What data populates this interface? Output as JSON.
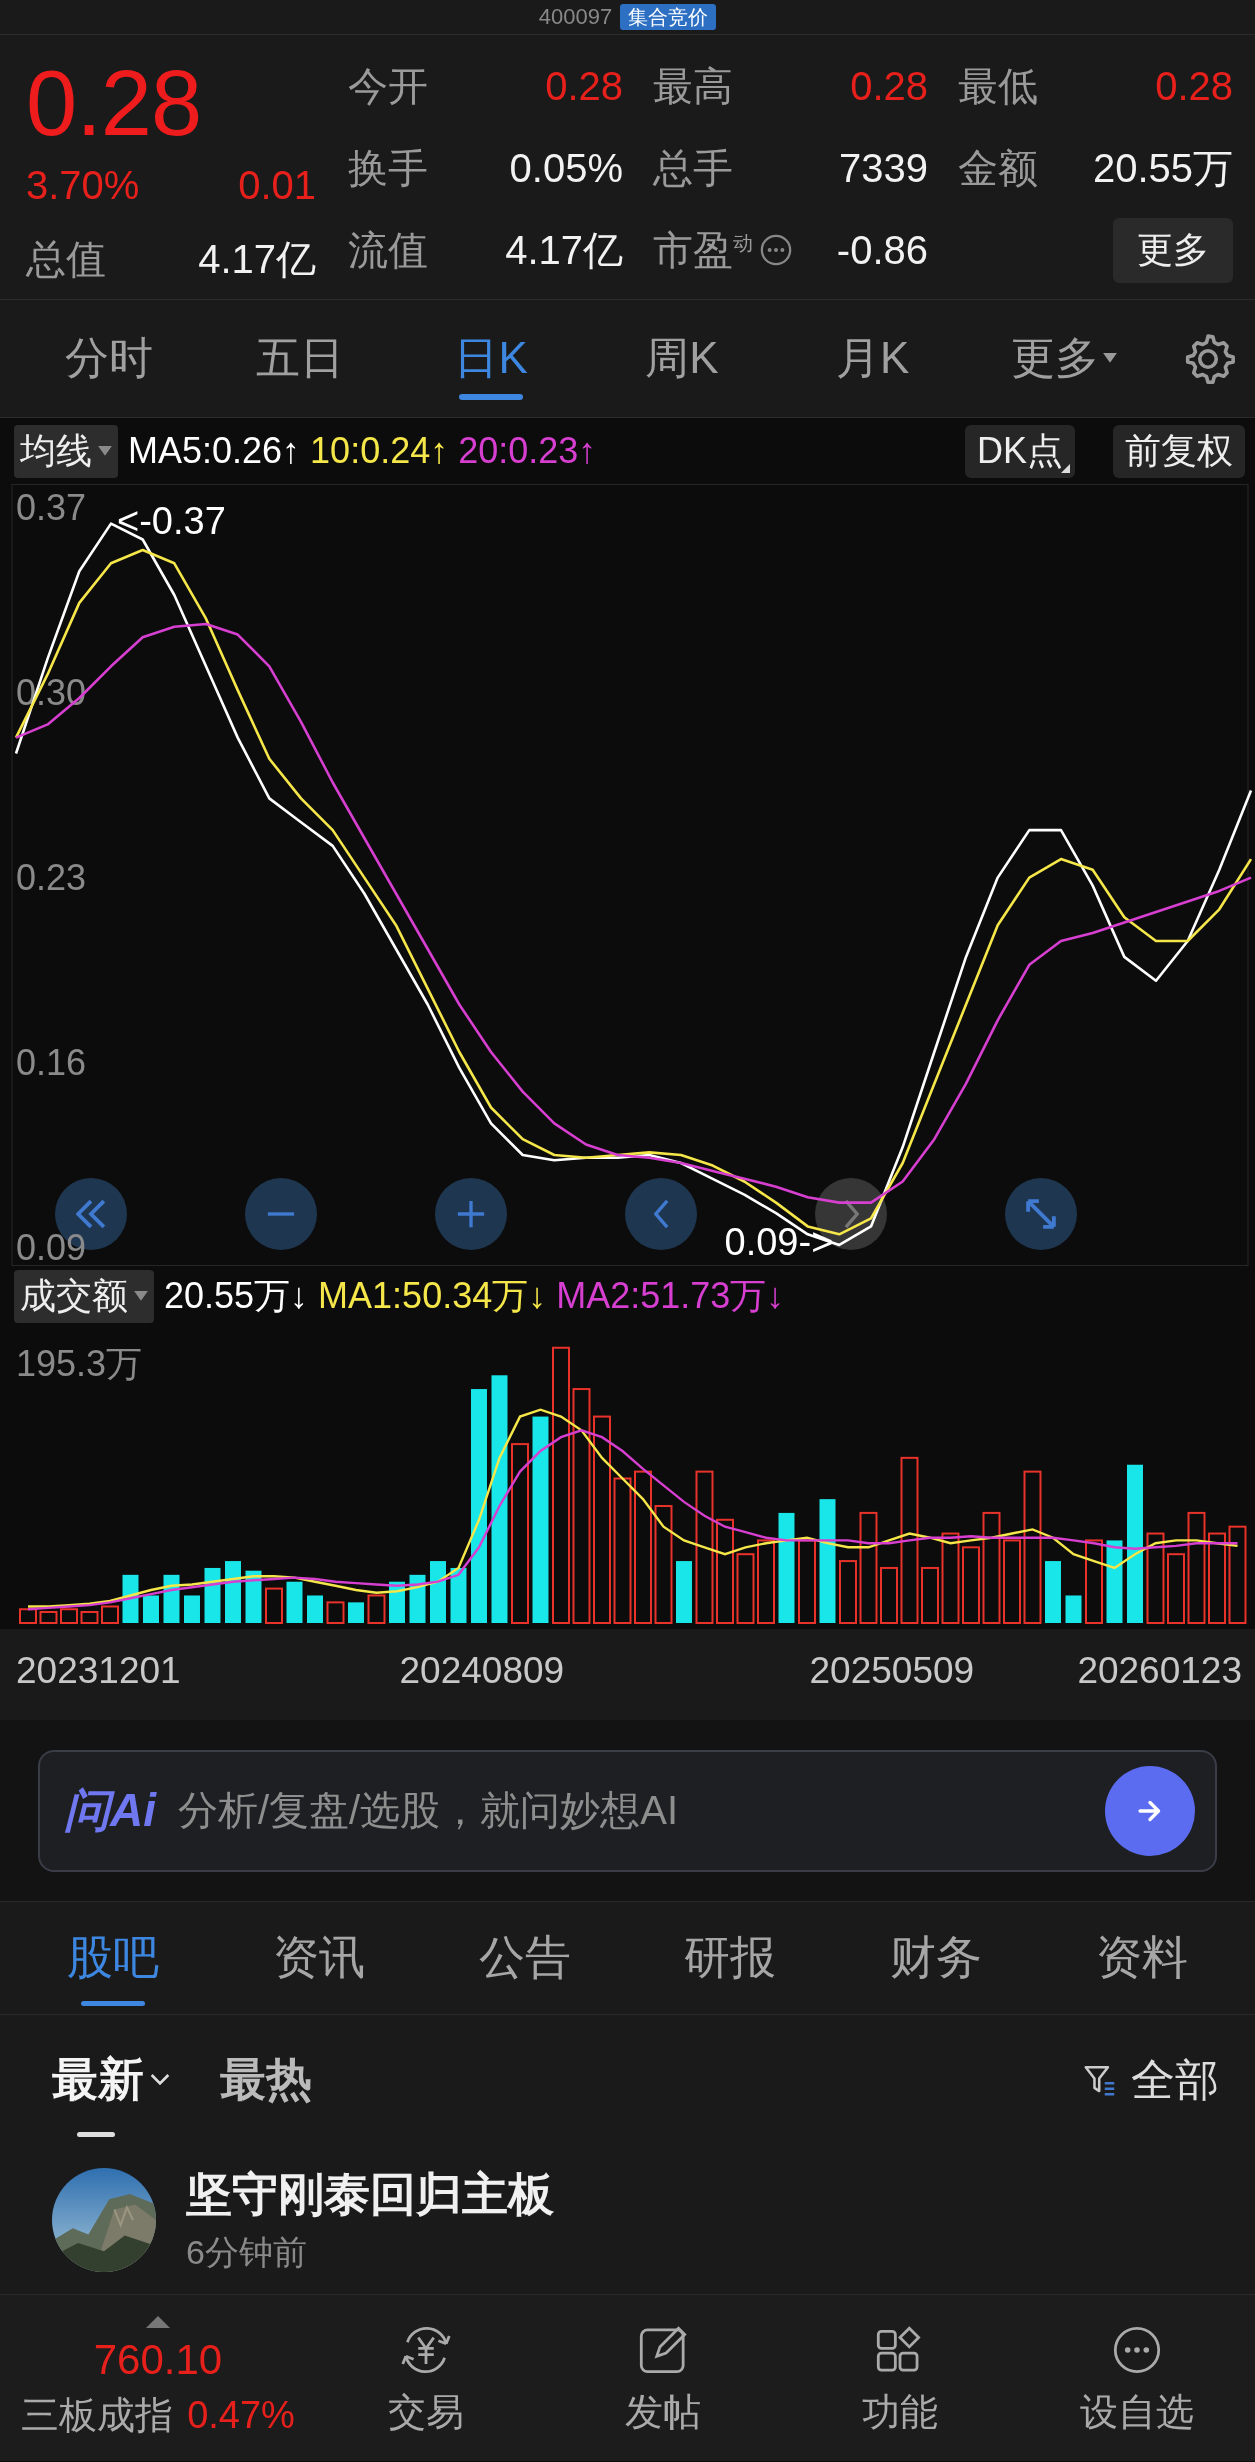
{
  "header": {
    "code": "400097",
    "status_badge": "集合竞价"
  },
  "quote": {
    "price": "0.28",
    "change_pct": "3.70%",
    "change": "0.01",
    "total_value": {
      "label": "总值",
      "value": "4.17亿"
    },
    "stats": [
      {
        "label": "今开",
        "value": "0.28",
        "kind": "up"
      },
      {
        "label": "最高",
        "value": "0.28",
        "kind": "up"
      },
      {
        "label": "最低",
        "value": "0.28",
        "kind": "up"
      },
      {
        "label": "换手",
        "value": "0.05%",
        "kind": "plain"
      },
      {
        "label": "总手",
        "value": "7339",
        "kind": "plain"
      },
      {
        "label": "金额",
        "value": "20.55万",
        "kind": "plain"
      },
      {
        "label": "流值",
        "value": "4.17亿",
        "kind": "plain"
      },
      {
        "label": "市盈$^{动}$",
        "value": "-0.86",
        "kind": "info"
      }
    ],
    "more_button": "更多"
  },
  "chart_tabs": [
    {
      "label": "分时",
      "selected": false,
      "kind": "plain"
    },
    {
      "label": "五日",
      "selected": false,
      "kind": "plain"
    },
    {
      "label": "日K",
      "selected": true,
      "kind": "plain"
    },
    {
      "label": "周K",
      "selected": false,
      "kind": "plain"
    },
    {
      "label": "月K",
      "selected": false,
      "kind": "plain"
    },
    {
      "label": "更多",
      "selected": false,
      "kind": "dropdown"
    }
  ],
  "ma_bar": {
    "indicator": "均线",
    "readings": [
      {
        "text": "MA5:0.26↑",
        "color": "#ffffff"
      },
      {
        "text": "10:0.24↑",
        "color": "#f5e64a"
      },
      {
        "text": "20:0.23↑",
        "color": "#d63fd0"
      }
    ],
    "buttons": [
      "DK点",
      "前复权"
    ]
  },
  "price_chart": {
    "chart_data": {
      "type": "line",
      "ylim": [
        0.084,
        0.38
      ],
      "yticks": [
        0.37,
        {
          "value": 0.3,
          "label": "0.30"
        },
        0.23,
        0.16,
        0.09
      ],
      "series": [
        {
          "color": "#ffffff",
          "values": [
            0.278,
            0.314,
            0.347,
            0.365,
            0.359,
            0.338,
            0.311,
            0.284,
            0.261,
            0.252,
            0.243,
            0.225,
            0.204,
            0.183,
            0.159,
            0.138,
            0.126,
            0.124,
            0.125,
            0.125,
            0.126,
            0.123,
            0.117,
            0.111,
            0.104,
            0.096,
            0.092,
            0.099,
            0.129,
            0.165,
            0.201,
            0.231,
            0.249,
            0.249,
            0.228,
            0.201,
            0.192,
            0.207,
            0.234,
            0.264
          ]
        },
        {
          "color": "#f5e64a",
          "values": [
            0.284,
            0.308,
            0.335,
            0.35,
            0.355,
            0.35,
            0.329,
            0.302,
            0.276,
            0.261,
            0.249,
            0.231,
            0.213,
            0.189,
            0.165,
            0.144,
            0.132,
            0.126,
            0.125,
            0.126,
            0.127,
            0.126,
            0.122,
            0.116,
            0.108,
            0.099,
            0.096,
            0.102,
            0.123,
            0.153,
            0.183,
            0.213,
            0.231,
            0.238,
            0.234,
            0.216,
            0.207,
            0.207,
            0.219,
            0.238
          ]
        },
        {
          "color": "#d63fd0",
          "values": [
            0.284,
            0.289,
            0.299,
            0.311,
            0.322,
            0.326,
            0.327,
            0.323,
            0.311,
            0.29,
            0.267,
            0.246,
            0.225,
            0.204,
            0.183,
            0.165,
            0.15,
            0.138,
            0.13,
            0.126,
            0.125,
            0.123,
            0.12,
            0.117,
            0.114,
            0.11,
            0.108,
            0.108,
            0.116,
            0.132,
            0.153,
            0.177,
            0.198,
            0.207,
            0.21,
            0.214,
            0.218,
            0.222,
            0.226,
            0.231
          ]
        }
      ],
      "annotations": [
        "<-0.37",
        "0.09->"
      ]
    }
  },
  "volume_bar": {
    "indicator": "成交额",
    "readings": [
      {
        "text": "20.55万↓",
        "color": "#ffffff"
      },
      {
        "text": "MA1:50.34万↓",
        "color": "#f5e64a"
      },
      {
        "text": "MA2:51.73万↓",
        "color": "#d63fd0"
      }
    ]
  },
  "volume_chart": {
    "max_label": "195.3万",
    "dates": [
      "20231201",
      "20240809",
      "20250509",
      "20260123"
    ]
  },
  "ai_bar": {
    "logo": "问Ai",
    "placeholder": "分析/复盘/选股，就问妙想AI"
  },
  "info_tabs": [
    {
      "label": "股吧",
      "selected": true
    },
    {
      "label": "资讯",
      "selected": false
    },
    {
      "label": "公告",
      "selected": false
    },
    {
      "label": "研报",
      "selected": false
    },
    {
      "label": "财务",
      "selected": false
    },
    {
      "label": "资料",
      "selected": false
    }
  ],
  "sort_tabs": [
    {
      "label": "最新",
      "selected": true,
      "kind": "dropdown"
    },
    {
      "label": "最热",
      "selected": false,
      "kind": "plain"
    }
  ],
  "filter": "全部",
  "posts": [
    {
      "title": "坚守刚泰回归主板",
      "time": "6分钟前"
    }
  ],
  "bottom_bar": {
    "index": {
      "value": "760.10",
      "name": "三板成指",
      "change": "0.47%"
    },
    "items": [
      {
        "label": "交易",
        "kind": "trade"
      },
      {
        "label": "发帖",
        "kind": "post"
      },
      {
        "label": "功能",
        "kind": "functions"
      },
      {
        "label": "设自选",
        "kind": "watchlist"
      }
    ]
  }
}
